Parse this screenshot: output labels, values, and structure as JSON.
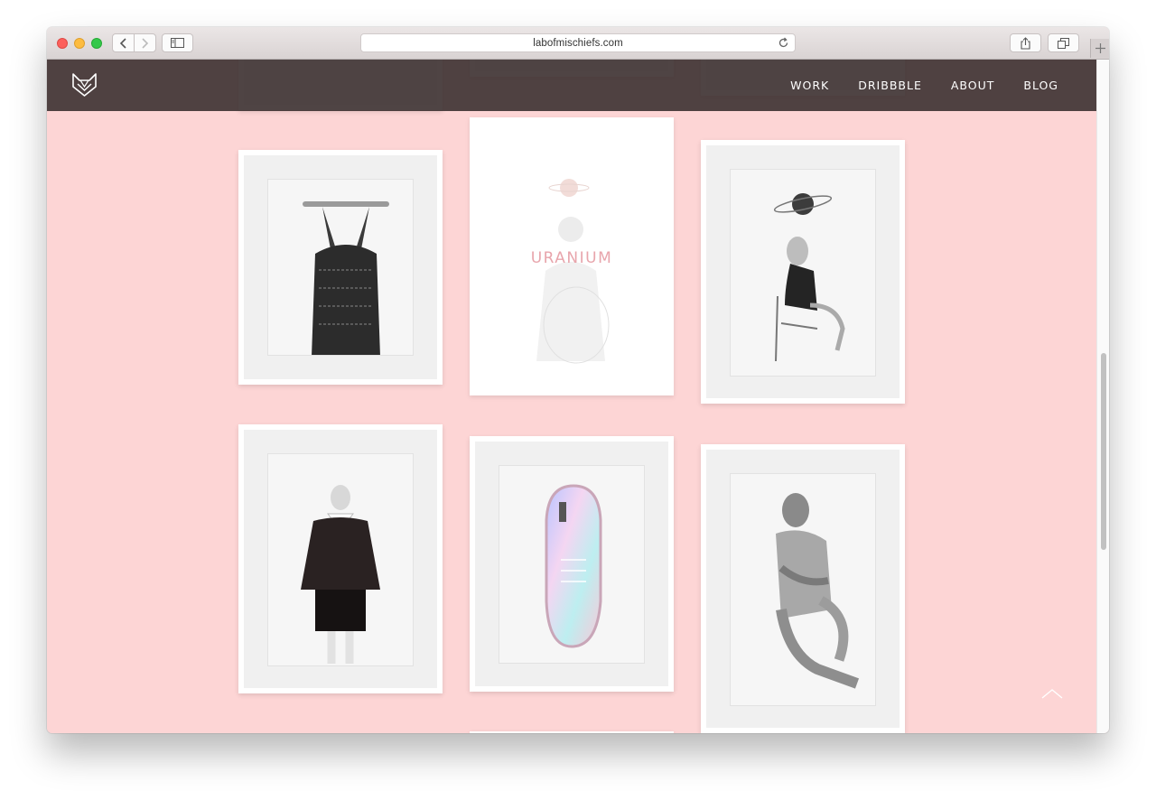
{
  "browser": {
    "url": "labofmischiefs.com",
    "icons": {
      "back": "chevron-left-icon",
      "forward": "chevron-right-icon",
      "sidebar": "sidebar-icon",
      "reload": "reload-icon",
      "share": "share-icon",
      "tabs": "tabs-icon",
      "new_tab": "plus-icon"
    }
  },
  "site": {
    "logo": "fox-logo-icon",
    "nav": [
      {
        "label": "WORK"
      },
      {
        "label": "DRIBBBLE"
      },
      {
        "label": "ABOUT"
      },
      {
        "label": "BLOG"
      }
    ],
    "colors": {
      "background": "#fdd5d5",
      "header": "#403434",
      "accent_text": "#e8a5ac"
    }
  },
  "gallery": {
    "featured_title": "URANIUM",
    "artworks": [
      {
        "subject": "figure-holding-tray"
      },
      {
        "subject": "uranium-cover"
      },
      {
        "subject": "woman-on-chair-with-saturn"
      },
      {
        "subject": "woman-in-black-cape"
      },
      {
        "subject": "holographic-shoe"
      },
      {
        "subject": "crouching-woman"
      }
    ]
  },
  "scroll_to_top": "chevron-up-icon"
}
